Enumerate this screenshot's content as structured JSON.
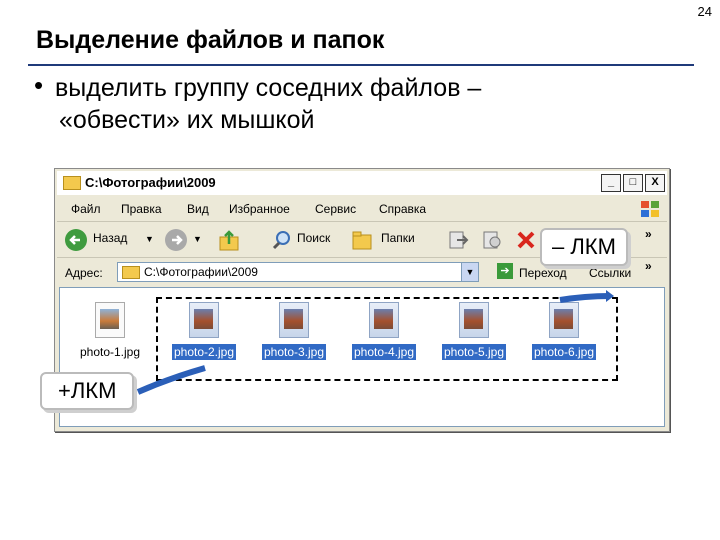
{
  "slide_number": "24",
  "title": "Выделение файлов и папок",
  "bullet_lines": [
    "выделить группу соседних файлов –",
    "«обвести» их мышкой"
  ],
  "window": {
    "title": "C:\\Фотографии\\2009",
    "controls": [
      "_",
      "□",
      "X"
    ],
    "menu": [
      "Файл",
      "Правка",
      "Вид",
      "Избранное",
      "Сервис",
      "Справка"
    ],
    "toolbar": {
      "back": "Назад",
      "search": "Поиск",
      "folders": "Папки"
    },
    "address_label": "Адрес:",
    "address_value": "C:\\Фотографии\\2009",
    "go_label": "Переход",
    "links_label": "Ссылки",
    "chevron": "»"
  },
  "files": [
    {
      "name": "photo-1.jpg",
      "selected": false
    },
    {
      "name": "photo-2.jpg",
      "selected": true
    },
    {
      "name": "photo-3.jpg",
      "selected": true
    },
    {
      "name": "photo-4.jpg",
      "selected": true
    },
    {
      "name": "photo-5.jpg",
      "selected": true
    },
    {
      "name": "photo-6.jpg",
      "selected": true
    }
  ],
  "callouts": {
    "release": "– ЛКМ",
    "press": "+ЛКМ"
  },
  "colors": {
    "selection": "#316ac5",
    "callout_arrow": "#2b5fb8"
  }
}
